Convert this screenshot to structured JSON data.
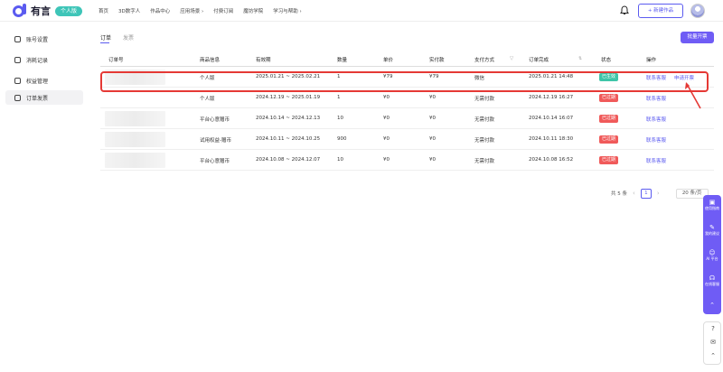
{
  "header": {
    "brand": "有言",
    "plan_tag": "个人版",
    "nav": [
      "首页",
      "3D数字人",
      "作品中心",
      "应用场景 ›",
      "付费订阅",
      "魔坊学院",
      "学习与帮助 ›"
    ],
    "new_work": "+ 新建作品"
  },
  "sidebar": {
    "items": [
      {
        "label": "账号设置",
        "icon": "user-icon"
      },
      {
        "label": "消耗记录",
        "icon": "record-icon"
      },
      {
        "label": "权益管理",
        "icon": "benefit-icon"
      },
      {
        "label": "订单发票",
        "icon": "invoice-icon"
      }
    ],
    "active_index": 3
  },
  "tabs": [
    "订单",
    "发票"
  ],
  "open_invoice_button": "批量开票",
  "table": {
    "headers": [
      "订单号",
      "商品信息",
      "有效期",
      "数量",
      "单价",
      "实付款",
      "支付方式",
      "订单完成",
      "状态",
      "操作"
    ],
    "rows": [
      {
        "product": "个人版",
        "validity": "2025.01.21 ~ 2025.02.21",
        "qty": "1",
        "price": "¥79",
        "paid": "¥79",
        "method": "微信",
        "completed": "2025.01.21 14:48",
        "status": "已生效",
        "actions": [
          "联系客服",
          "申请开票"
        ]
      },
      {
        "product": "个人版",
        "validity": "2024.12.19 ~ 2025.01.19",
        "qty": "1",
        "price": "¥0",
        "paid": "¥0",
        "method": "无需付款",
        "completed": "2024.12.19 16:27",
        "status": "已过期",
        "actions": [
          "联系客服"
        ]
      },
      {
        "product": "平台心意赠币",
        "validity": "2024.10.14 ~ 2024.12.13",
        "qty": "10",
        "price": "¥0",
        "paid": "¥0",
        "method": "无需付款",
        "completed": "2024.10.14 16:07",
        "status": "已过期",
        "actions": [
          "联系客服"
        ]
      },
      {
        "product": "试用权益-赠币",
        "validity": "2024.10.11 ~ 2024.10.25",
        "qty": "900",
        "price": "¥0",
        "paid": "¥0",
        "method": "无需付款",
        "completed": "2024.10.11 18:30",
        "status": "已过期",
        "actions": [
          "联系客服"
        ]
      },
      {
        "product": "平台心意赠币",
        "validity": "2024.10.08 ~ 2024.12.07",
        "qty": "10",
        "price": "¥0",
        "paid": "¥0",
        "method": "无需付款",
        "completed": "2024.10.08 16:52",
        "status": "已过期",
        "actions": [
          "联系客服"
        ]
      }
    ]
  },
  "pagination": {
    "total": "共 5 条",
    "current": "1",
    "page_size": "20 条/页"
  },
  "float_bar": {
    "items": [
      {
        "label": "使用指南",
        "icon": "guide-icon"
      },
      {
        "label": "我的建议",
        "icon": "feedback-icon"
      },
      {
        "label": "AI 平台",
        "icon": "ai-icon"
      },
      {
        "label": "在线客服",
        "icon": "headset-icon"
      }
    ]
  },
  "colors": {
    "accent": "#5b5bf0",
    "active_badge": "#3ec5a8",
    "expired_badge": "#f05a5a",
    "highlight": "#e53935"
  }
}
